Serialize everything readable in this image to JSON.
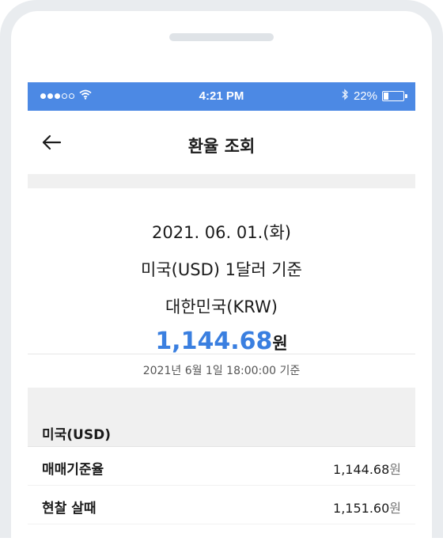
{
  "status_bar": {
    "time": "4:21 PM",
    "battery_text": "22%",
    "wifi_icon": "wifi-icon",
    "bluetooth_icon": "bluetooth-icon",
    "color": "#4c89e4"
  },
  "nav": {
    "title": "환율 조회",
    "back_icon": "arrow-left-icon"
  },
  "rate": {
    "date": "2021. 06. 01.(화)",
    "basis": "미국(USD) 1달러 기준",
    "target": "대한민국(KRW)",
    "value": "1,144.68",
    "unit": "원",
    "accent": "#3a7fe0"
  },
  "timestamp": "2021년 6월 1일 18:00:00 기준",
  "section": {
    "title": "미국(USD)",
    "rows": [
      {
        "label": "매매기준율",
        "value": "1,144.68",
        "unit": "원"
      },
      {
        "label": "현찰 살때",
        "value": "1,151.60",
        "unit": "원"
      }
    ]
  }
}
